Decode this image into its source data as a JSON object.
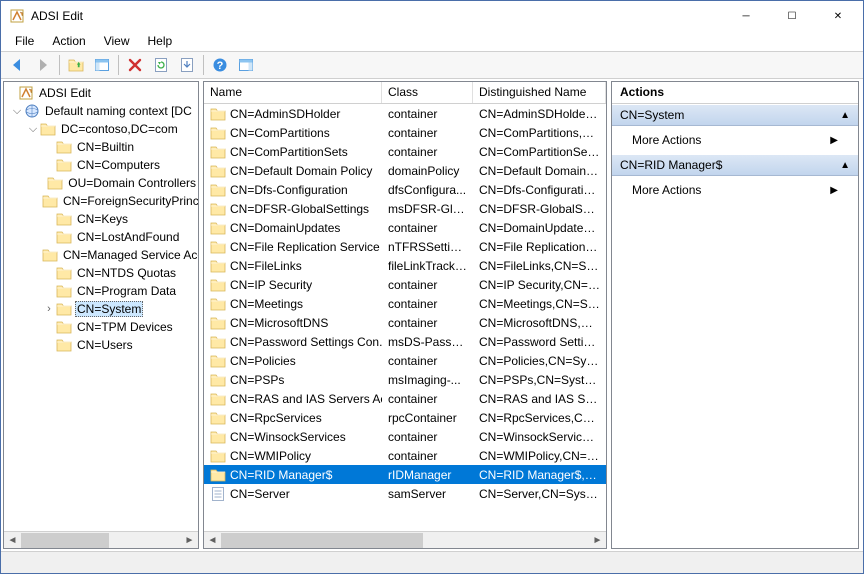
{
  "window": {
    "title": "ADSI Edit"
  },
  "menu": {
    "file": "File",
    "action": "Action",
    "view": "View",
    "help": "Help"
  },
  "tree": {
    "root": "ADSI Edit",
    "context": "Default naming context [DC",
    "domain": "DC=contoso,DC=com",
    "items": [
      "CN=Builtin",
      "CN=Computers",
      "OU=Domain Controllers",
      "CN=ForeignSecurityPrincipals",
      "CN=Keys",
      "CN=LostAndFound",
      "CN=Managed Service Accounts",
      "CN=NTDS Quotas",
      "CN=Program Data",
      "CN=System",
      "CN=TPM Devices",
      "CN=Users"
    ],
    "selected_index": 9
  },
  "list": {
    "columns": {
      "name": "Name",
      "class": "Class",
      "dn": "Distinguished Name"
    },
    "rows": [
      {
        "icon": "folder",
        "name": "CN=AdminSDHolder",
        "class": "container",
        "dn": "CN=AdminSDHolder,CN"
      },
      {
        "icon": "folder",
        "name": "CN=ComPartitions",
        "class": "container",
        "dn": "CN=ComPartitions,CN="
      },
      {
        "icon": "folder",
        "name": "CN=ComPartitionSets",
        "class": "container",
        "dn": "CN=ComPartitionSets,C"
      },
      {
        "icon": "folder",
        "name": "CN=Default Domain Policy",
        "class": "domainPolicy",
        "dn": "CN=Default Domain Po"
      },
      {
        "icon": "folder",
        "name": "CN=Dfs-Configuration",
        "class": "dfsConfigura...",
        "dn": "CN=Dfs-Configuration,"
      },
      {
        "icon": "folder",
        "name": "CN=DFSR-GlobalSettings",
        "class": "msDFSR-Glo...",
        "dn": "CN=DFSR-GlobalSetting"
      },
      {
        "icon": "folder",
        "name": "CN=DomainUpdates",
        "class": "container",
        "dn": "CN=DomainUpdates,CN"
      },
      {
        "icon": "folder",
        "name": "CN=File Replication Service",
        "class": "nTFRSSettings",
        "dn": "CN=File Replication Ser"
      },
      {
        "icon": "folder",
        "name": "CN=FileLinks",
        "class": "fileLinkTracki...",
        "dn": "CN=FileLinks,CN=Syste"
      },
      {
        "icon": "folder",
        "name": "CN=IP Security",
        "class": "container",
        "dn": "CN=IP Security,CN=Sy"
      },
      {
        "icon": "folder",
        "name": "CN=Meetings",
        "class": "container",
        "dn": "CN=Meetings,CN=Syste"
      },
      {
        "icon": "folder",
        "name": "CN=MicrosoftDNS",
        "class": "container",
        "dn": "CN=MicrosoftDNS,CN="
      },
      {
        "icon": "folder",
        "name": "CN=Password Settings Con...",
        "class": "msDS-Passw...",
        "dn": "CN=Password Settings C"
      },
      {
        "icon": "folder",
        "name": "CN=Policies",
        "class": "container",
        "dn": "CN=Policies,CN=System"
      },
      {
        "icon": "folder",
        "name": "CN=PSPs",
        "class": "msImaging-...",
        "dn": "CN=PSPs,CN=System,D"
      },
      {
        "icon": "folder",
        "name": "CN=RAS and IAS Servers Ac...",
        "class": "container",
        "dn": "CN=RAS and IAS Servers"
      },
      {
        "icon": "folder",
        "name": "CN=RpcServices",
        "class": "rpcContainer",
        "dn": "CN=RpcServices,CN=Sy"
      },
      {
        "icon": "folder",
        "name": "CN=WinsockServices",
        "class": "container",
        "dn": "CN=WinsockServices,CN"
      },
      {
        "icon": "folder",
        "name": "CN=WMIPolicy",
        "class": "container",
        "dn": "CN=WMIPolicy,CN=Sys"
      },
      {
        "icon": "folder",
        "name": "CN=RID Manager$",
        "class": "rIDManager",
        "dn": "CN=RID Manager$,CN="
      },
      {
        "icon": "doc",
        "name": "CN=Server",
        "class": "samServer",
        "dn": "CN=Server,CN=System,"
      }
    ],
    "selected_index": 19
  },
  "actions": {
    "header": "Actions",
    "group1": {
      "title": "CN=System",
      "item": "More Actions"
    },
    "group2": {
      "title": "CN=RID Manager$",
      "item": "More Actions"
    }
  }
}
